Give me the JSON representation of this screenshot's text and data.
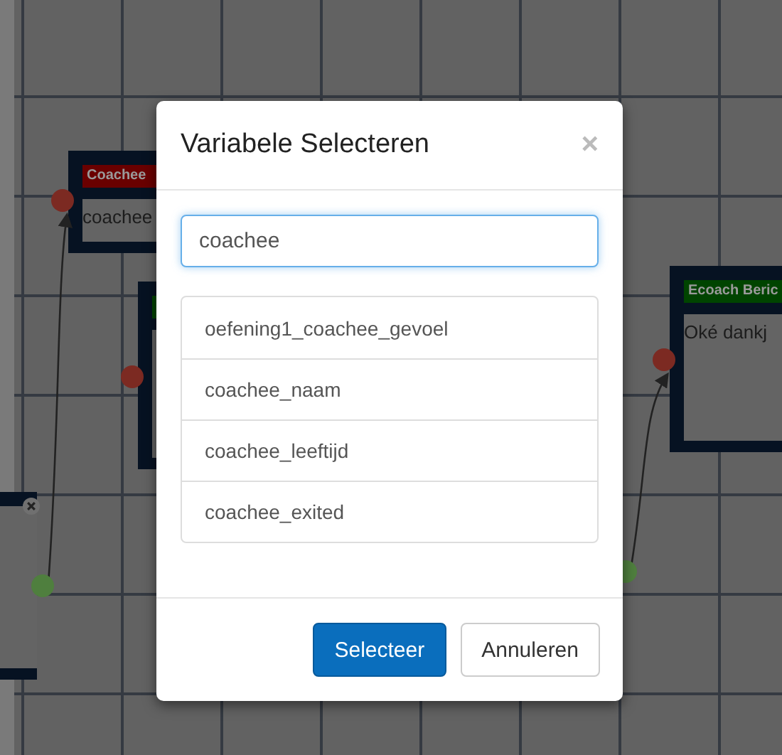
{
  "canvas": {
    "nodes": [
      {
        "header": "Coachee",
        "color": "#6a0000",
        "body": "coachee"
      },
      {
        "color": "#004400"
      },
      {
        "has_close": true
      },
      {
        "header": "Ecoach Beric",
        "color": "#004400",
        "body": "Oké dankj"
      }
    ],
    "ports": [
      {
        "color": "#7c2a22"
      },
      {
        "color": "#7c2a22"
      },
      {
        "color": "#4f7f3e"
      },
      {
        "color": "#7c2a22"
      },
      {
        "color": "#4f7f3e"
      }
    ]
  },
  "dialog": {
    "title": "Variabele Selecteren",
    "close": "×",
    "search": {
      "value": "coachee"
    },
    "options": [
      {
        "label": "oefening1_coachee_gevoel"
      },
      {
        "label": "coachee_naam"
      },
      {
        "label": "coachee_leeftijd"
      },
      {
        "label": "coachee_exited"
      }
    ],
    "buttons": [
      {
        "label": "Selecteer",
        "kind": "primary"
      },
      {
        "label": "Annuleren",
        "kind": "default"
      }
    ]
  }
}
